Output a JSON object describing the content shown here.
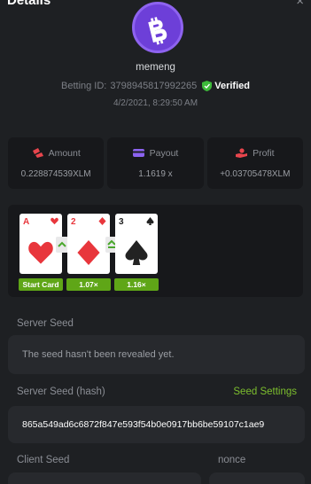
{
  "header": {
    "title": "Details",
    "close_label": "×"
  },
  "player": {
    "username": "memeng",
    "betting_id_label": "Betting ID:",
    "betting_id": "3798945817992265",
    "verified_label": "Verified",
    "datetime": "4/2/2021, 8:29:50 AM"
  },
  "stats": {
    "amount_label": "Amount",
    "amount_value": "0.228874539XLM",
    "payout_label": "Payout",
    "payout_value": "1.1619 x",
    "profit_label": "Profit",
    "profit_value": "+0.03705478XLM"
  },
  "game": {
    "cards": [
      {
        "rank": "A",
        "suit": "heart"
      },
      {
        "rank": "2",
        "suit": "diamond"
      },
      {
        "rank": "3",
        "suit": "spade"
      }
    ],
    "badges": [
      "Start Card",
      "1.07×",
      "1.16×"
    ]
  },
  "seeds": {
    "server_seed_label": "Server Seed",
    "server_seed_value": "The seed hasn't been revealed yet.",
    "server_hash_label": "Server Seed (hash)",
    "seed_settings_label": "Seed Settings",
    "server_hash_value": "865a549ad6c6872f847e593f54b0e0917bb6be59107c1ae9",
    "client_seed_label": "Client Seed",
    "nonce_label": "nonce"
  },
  "colors": {
    "background": "#1e2023",
    "panel": "#17181b",
    "field": "#27292d",
    "accent_green": "#5fa617",
    "link_green": "#7dbf2e",
    "avatar_purple": "#6d3fd8"
  }
}
